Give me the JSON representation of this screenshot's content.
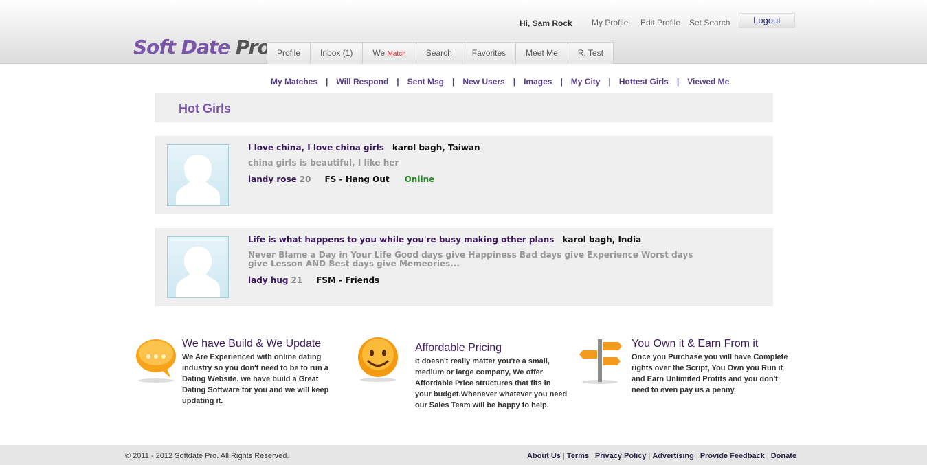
{
  "header": {
    "logo": {
      "main": "Soft Date ",
      "pro": "Pro"
    },
    "greeting": "Hi, Sam Rock",
    "links": [
      "My Profile",
      "Edit Profile",
      "Set Search"
    ],
    "logout": "Logout"
  },
  "tabs": [
    {
      "label": "Profile"
    },
    {
      "label": "Inbox (1)"
    },
    {
      "label": "We ",
      "sub": "Match"
    },
    {
      "label": "Search"
    },
    {
      "label": "Favorites"
    },
    {
      "label": "Meet Me"
    },
    {
      "label": "R. Test"
    }
  ],
  "subnav": [
    "My Matches",
    "Will Respond",
    "Sent Msg",
    "New Users",
    "Images",
    "My City",
    "Hottest Girls",
    "Viewed Me"
  ],
  "subnav_separator": "|",
  "page_title": "Hot Girls",
  "profiles": [
    {
      "headline": "I love china, I love china girls",
      "location": "karol bagh, Taiwan",
      "description": "china girls is beautiful, I like her",
      "name": "landy rose",
      "age": "20",
      "seeking": "FS - Hang Out",
      "status": "Online"
    },
    {
      "headline": "Life is what happens to you while you're busy making other plans",
      "location": "karol bagh, India",
      "description": "Never Blame a Day in Your Life Good days give Happiness Bad days give Experience Worst days give Lesson AND Best days give Memeories...",
      "name": "lady hug",
      "age": "21",
      "seeking": "FSM - Friends",
      "status": ""
    }
  ],
  "features": [
    {
      "icon": "speech-bubble-icon",
      "title": "We have Build & We Update",
      "text": "We Are Experienced with online dating industry so you don't need to be to run a Dating Website. we have build a Great Dating Software for you and we will keep updating it."
    },
    {
      "icon": "smiley-face-icon",
      "title": "Affordable Pricing",
      "text": "It doesn't really matter you're a small, medium or large company, We offer Affordable Price structures that fits in your budget.Whenever whatever you need our Sales Team will be happy to help."
    },
    {
      "icon": "signpost-icon",
      "title": "You Own it & Earn From it",
      "text": "Once you Purchase you will have Complete rights over the Script, You Own you Run it and Earn Unlimited Profits and you don't need to even pay us a penny."
    }
  ],
  "footer": {
    "copyright": "© 2011 - 2012 Softdate Pro. All Rights Reserved.",
    "links": [
      "About Us",
      "Terms",
      "Privacy Policy",
      "Advertising",
      "Provide Feedback",
      "Donate"
    ],
    "separator": "|"
  },
  "colors": {
    "brand": "#7a56a8",
    "link": "#553c86",
    "online": "#2a8a2a",
    "match": "#c0282a"
  }
}
